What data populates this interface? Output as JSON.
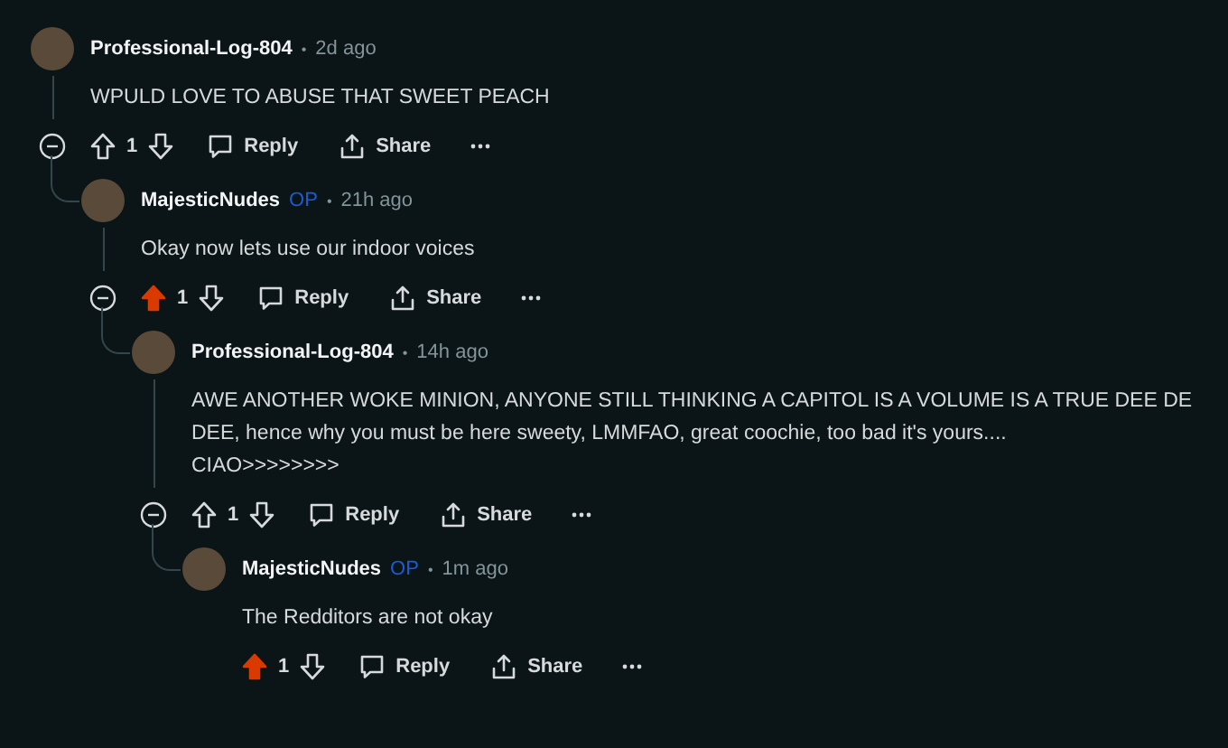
{
  "comments": [
    {
      "author": "Professional-Log-804",
      "separator": "•",
      "time": "2d ago",
      "body": "WPULD LOVE TO ABUSE THAT SWEET PEACH",
      "upvoted": false,
      "score": "1",
      "actions": [
        "Reply",
        "Share"
      ],
      "children": [
        {
          "author": "MajesticNudes",
          "flair": "OP",
          "separator": "•",
          "time": "21h ago",
          "body": "Okay now lets use our indoor voices",
          "upvoted": true,
          "score": "1",
          "actions": [
            "Reply",
            "Share"
          ],
          "children": [
            {
              "author": "Professional-Log-804",
              "separator": "•",
              "time": "14h ago",
              "body": "AWE ANOTHER WOKE MINION, ANYONE STILL THINKING A CAPITOL IS A VOLUME IS A TRUE DEE DE DEE, hence why you must be here sweety, LMMFAO, great coochie, too bad it's yours....\nCIAO>>>>>>>>",
              "upvoted": false,
              "score": "1",
              "actions": [
                "Reply",
                "Share"
              ],
              "children": [
                {
                  "author": "MajesticNudes",
                  "flair": "OP",
                  "separator": "•",
                  "time": "1m ago",
                  "body": "The Redditors are not okay",
                  "upvoted": true,
                  "score": "1",
                  "actions": [
                    "Reply",
                    "Share"
                  ]
                }
              ]
            }
          ]
        }
      ]
    }
  ]
}
